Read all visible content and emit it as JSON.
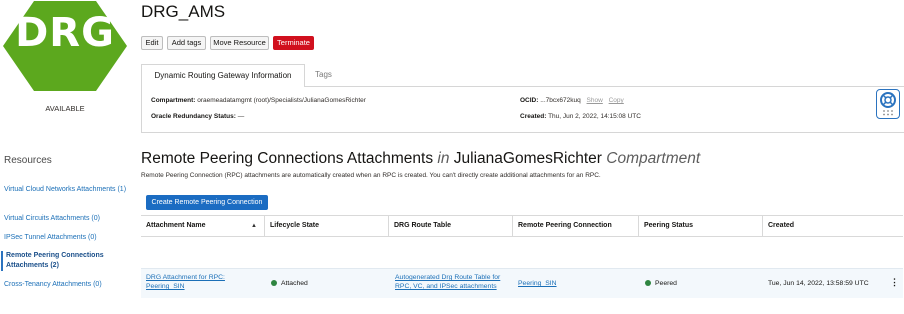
{
  "colors": {
    "hex_green": "#5ca81e",
    "primary_blue": "#1b6cc2",
    "terminate_red": "#d1101e",
    "status_green": "#2e8540"
  },
  "logo": {
    "text": "DRG",
    "state": "AVAILABLE"
  },
  "page": {
    "title": "DRG_AMS"
  },
  "actions": {
    "edit": "Edit",
    "add_tags": "Add tags",
    "move_resource": "Move Resource",
    "terminate": "Terminate"
  },
  "tabs": {
    "info": "Dynamic Routing Gateway Information",
    "tags": "Tags"
  },
  "info": {
    "compartment_label": "Compartment:",
    "compartment_value": "oraemeadatamgmt (root)/Specialists/JulianaGomesRichter",
    "redundancy_label": "Oracle Redundancy Status:",
    "redundancy_value": "—",
    "ocid_label": "OCID:",
    "ocid_value": "...7bcx672kuq",
    "ocid_show": "Show",
    "ocid_copy": "Copy",
    "created_label": "Created:",
    "created_value": "Thu, Jun 2, 2022, 14:15:08 UTC"
  },
  "sidebar": {
    "heading": "Resources",
    "items": [
      {
        "label": "Virtual Cloud Networks Attachments (1)"
      },
      {
        "label": "Virtual Circuits Attachments (0)"
      },
      {
        "label": "IPSec Tunnel Attachments (0)"
      },
      {
        "label": "Remote Peering Connections Attachments (2)"
      },
      {
        "label": "Cross-Tenancy Attachments (0)"
      }
    ]
  },
  "section": {
    "title": "Remote Peering Connections Attachments",
    "in_word": "in",
    "compartment": "JulianaGomesRichter",
    "compartment_word": "Compartment",
    "description": "Remote Peering Connection (RPC) attachments are automatically created when an RPC is created. You can't directly create additional attachments for an RPC.",
    "create_button": "Create Remote Peering Connection"
  },
  "table": {
    "sort_indicator": "▲",
    "headers": [
      "Attachment Name",
      "Lifecycle State",
      "DRG Route Table",
      "Remote Peering Connection",
      "Peering Status",
      "Created"
    ],
    "rows": [
      {
        "name": "DRG Attachment for RPC: Peering_SIN",
        "lifecycle": "Attached",
        "route_table": "Autogenerated Drg Route Table for RPC, VC, and IPSec attachments",
        "rpc": "Peering_SIN",
        "peering_status": "Peered",
        "created": "Tue, Jun 14, 2022, 13:58:59 UTC",
        "actions_icon": "⋮"
      }
    ]
  }
}
